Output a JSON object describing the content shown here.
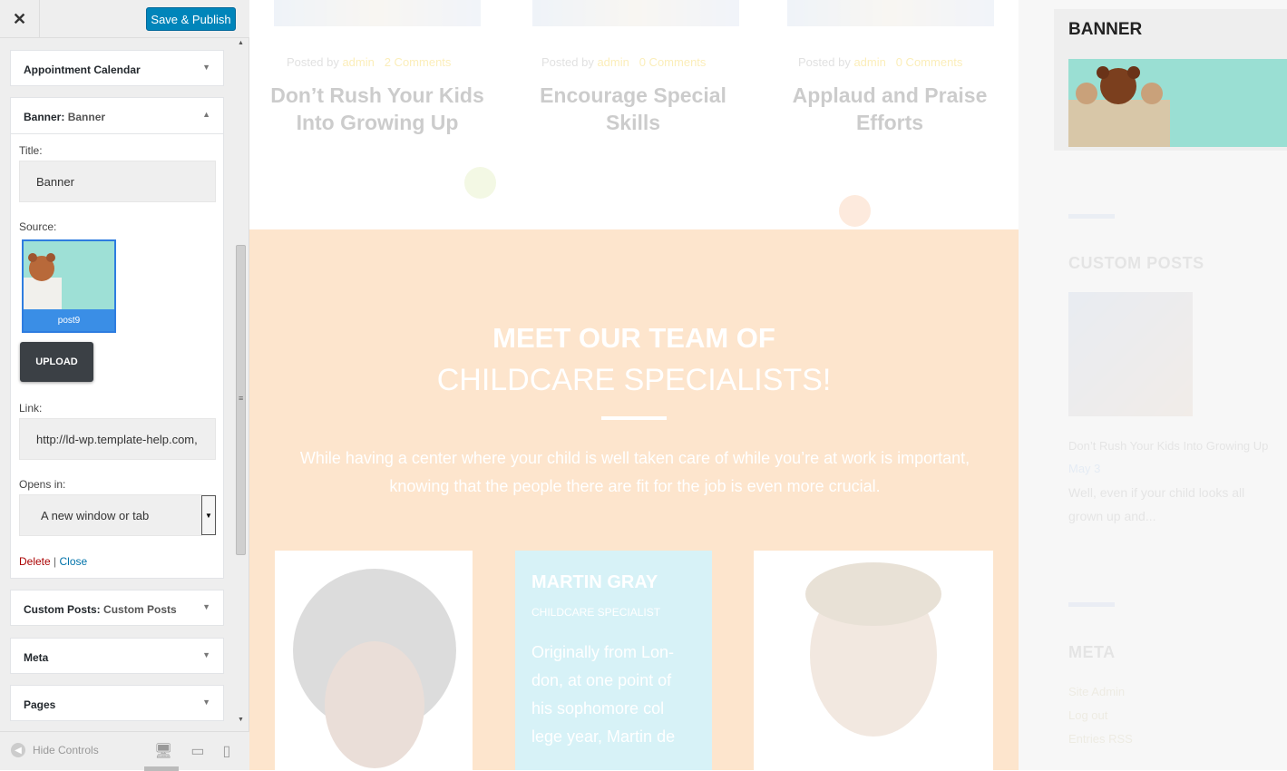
{
  "topbar": {
    "close_icon": "close-icon",
    "publish_label": "Save & Publish"
  },
  "widgets": {
    "appointment": {
      "title": "Appointment Calendar"
    },
    "banner": {
      "title": "Banner:",
      "subtitle": "Banner",
      "title_label": "Title:",
      "title_value": "Banner",
      "source_label": "Source:",
      "thumb_caption": "post9",
      "upload_label": "UPLOAD",
      "link_label": "Link:",
      "link_value": "http://ld-wp.template-help.com,",
      "opens_label": "Opens in:",
      "opens_value": "A new window or tab",
      "delete_label": "Delete",
      "sep": "|",
      "close_label": "Close"
    },
    "custom_posts": {
      "title": "Custom Posts:",
      "subtitle": "Custom Posts"
    },
    "meta": {
      "title": "Meta"
    },
    "pages": {
      "title": "Pages"
    }
  },
  "footer": {
    "hide_controls": "Hide Controls"
  },
  "preview": {
    "posts": [
      {
        "posted_by": "Posted by",
        "author": "admin",
        "comments": "2 Comments",
        "title_l1": "Don’t Rush Your Kids",
        "title_l2": "Into Growing Up"
      },
      {
        "posted_by": "Posted by",
        "author": "admin",
        "comments": "0 Comments",
        "title_l1": "Encourage Special",
        "title_l2": "Skills"
      },
      {
        "posted_by": "Posted by",
        "author": "admin",
        "comments": "0 Comments",
        "title_l1": "Applaud and Praise",
        "title_l2": "Efforts"
      }
    ],
    "team": {
      "heading1": "MEET OUR TEAM OF",
      "heading2": "CHILDCARE SPECIALISTS!",
      "desc": "While having a center where your child is well taken care of while you’re at work is important, knowing that the people there are fit for the job is even more crucial.",
      "member_name": "MARTIN GRAY",
      "member_role": "CHILDCARE SPECIALIST",
      "member_desc": "Originally from Lon-don, at one point of his sophomore col lege year, Martin de"
    }
  },
  "sidebar": {
    "banner_title": "BANNER",
    "custom_posts_title": "CUSTOM POSTS",
    "post_title": "Don’t Rush Your Kids Into Growing Up",
    "post_date": "May 3",
    "post_excerpt_l1": "Well, even if your child looks all",
    "post_excerpt_l2": "grown up and...",
    "meta_title": "META",
    "meta_items": [
      "Site Admin",
      "Log out",
      "Entries RSS"
    ]
  },
  "colors": {
    "publish": "#0085ba",
    "accent_yellow": "#f2c518",
    "team_bg": "#fde0c4",
    "upload": "#3b4045",
    "delete": "#a00",
    "close": "#0073aa"
  }
}
